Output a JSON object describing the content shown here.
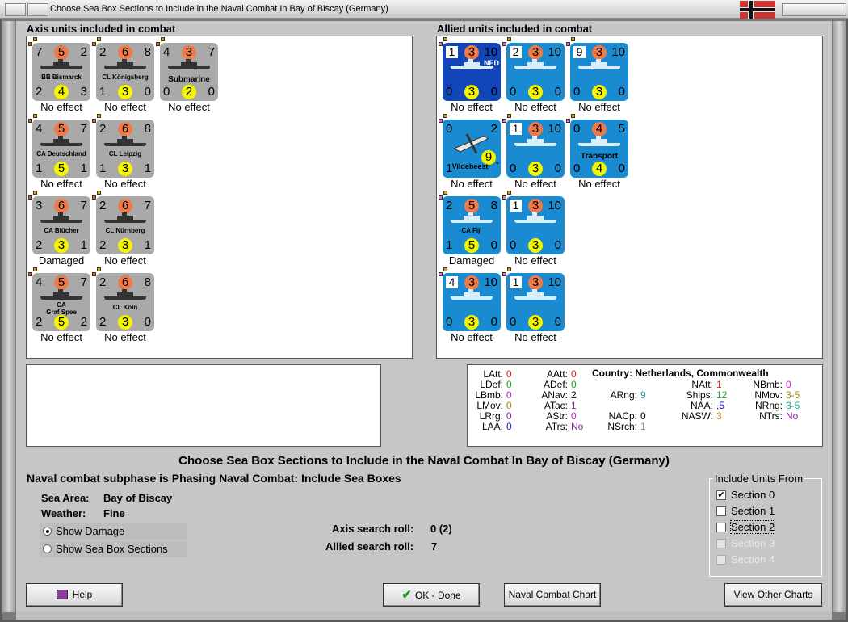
{
  "window": {
    "title": "Choose Sea Box Sections to Include in the Naval Combat In Bay of Biscay (Germany)"
  },
  "axis": {
    "title": "Axis units included in combat",
    "units": [
      {
        "tl": "7",
        "tm": "5",
        "tr": "2",
        "name": "BB Bismarck",
        "bl": "2",
        "bm": "4",
        "br": "3",
        "effect": "No effect"
      },
      {
        "tl": "2",
        "tm": "6",
        "tr": "8",
        "name": "CL Königsberg",
        "bl": "1",
        "bm": "3",
        "br": "0",
        "effect": "No effect"
      },
      {
        "tl": "4",
        "tm": "3",
        "tr": "7",
        "name": "Submarine",
        "bl": "0",
        "bm": "2",
        "br": "0",
        "effect": "No effect"
      },
      {
        "tl": "4",
        "tm": "5",
        "tr": "7",
        "name": "CA Deutschland",
        "bl": "1",
        "bm": "5",
        "br": "1",
        "effect": "No effect"
      },
      {
        "tl": "2",
        "tm": "6",
        "tr": "8",
        "name": "CL Leipzig",
        "bl": "1",
        "bm": "3",
        "br": "1",
        "effect": "No effect"
      },
      {
        "tl": "3",
        "tm": "6",
        "tr": "7",
        "name": "CA Blücher",
        "bl": "2",
        "bm": "3",
        "br": "1",
        "effect": "Damaged"
      },
      {
        "tl": "2",
        "tm": "6",
        "tr": "7",
        "name": "CL Nürnberg",
        "bl": "2",
        "bm": "3",
        "br": "1",
        "effect": "No effect"
      },
      {
        "tl": "4",
        "tm": "5",
        "tr": "7",
        "name": "CA",
        "name2": "Graf Spee",
        "bl": "2",
        "bm": "5",
        "br": "2",
        "effect": "No effect"
      },
      {
        "tl": "2",
        "tm": "6",
        "tr": "8",
        "name": "CL Köln",
        "bl": "2",
        "bm": "3",
        "br": "0",
        "effect": "No effect"
      }
    ]
  },
  "allied": {
    "title": "Allied units included in combat",
    "units": [
      {
        "tl": "1",
        "tm": "3",
        "tr": "10",
        "tag": "NED",
        "bl": "0",
        "bm": "3",
        "br": "0",
        "effect": "No effect"
      },
      {
        "tl": "2",
        "tm": "3",
        "tr": "10",
        "bl": "0",
        "bm": "3",
        "br": "0",
        "effect": "No effect"
      },
      {
        "tl": "9",
        "tm": "3",
        "tr": "10",
        "bl": "0",
        "bm": "3",
        "br": "0",
        "effect": "No effect"
      },
      {
        "tl": "0",
        "tr": "2",
        "name": "Vildebeest",
        "bl": "1",
        "bm": "9",
        "br": "*",
        "effect": "No effect"
      },
      {
        "tl": "1",
        "tm": "3",
        "tr": "10",
        "bl": "0",
        "bm": "3",
        "br": "0",
        "effect": "No effect"
      },
      {
        "tl": "0",
        "tm": "4",
        "tr": "5",
        "name": "Transport",
        "bl": "0",
        "bm": "4",
        "br": "0",
        "effect": "No effect"
      },
      {
        "tl": "2",
        "tm": "5",
        "tr": "8",
        "name": "CA Fiji",
        "bl": "1",
        "bm": "5",
        "br": "0",
        "effect": "Damaged"
      },
      {
        "tl": "1",
        "tm": "3",
        "tr": "10",
        "bl": "0",
        "bm": "3",
        "br": "0",
        "effect": "No effect"
      },
      {
        "tl": "4",
        "tm": "3",
        "tr": "10",
        "bl": "0",
        "bm": "3",
        "br": "0",
        "effect": "No effect"
      },
      {
        "tl": "1",
        "tm": "3",
        "tr": "10",
        "bl": "0",
        "bm": "3",
        "br": "0",
        "effect": "No effect"
      }
    ]
  },
  "stats": {
    "country_label": "Country:",
    "country": "Netherlands, Commonwealth",
    "items": [
      {
        "k": "LAtt:",
        "v": "0"
      },
      {
        "k": "LDef:",
        "v": "0"
      },
      {
        "k": "LBmb:",
        "v": "0"
      },
      {
        "k": "LMov:",
        "v": "0"
      },
      {
        "k": "LRrg:",
        "v": "0"
      },
      {
        "k": "LAA:",
        "v": "0"
      },
      {
        "k": "AAtt:",
        "v": "0"
      },
      {
        "k": "ADef:",
        "v": "0"
      },
      {
        "k": "ANav:",
        "v": "2"
      },
      {
        "k": "ATac:",
        "v": "1"
      },
      {
        "k": "AStr:",
        "v": "0"
      },
      {
        "k": "ATrs:",
        "v": "No"
      },
      {
        "k": "ARng:",
        "v": "9"
      },
      {
        "k": "NACp:",
        "v": "0"
      },
      {
        "k": "NSrch:",
        "v": "1"
      },
      {
        "k": "NAtt:",
        "v": "1"
      },
      {
        "k": "Ships:",
        "v": "12"
      },
      {
        "k": "NAA:",
        "v": ",5"
      },
      {
        "k": "NASW:",
        "v": "3"
      },
      {
        "k": "NBmb:",
        "v": "0"
      },
      {
        "k": "NMov:",
        "v": "3-5"
      },
      {
        "k": "NRng:",
        "v": "3-5"
      },
      {
        "k": "NTrs:",
        "v": "No"
      }
    ]
  },
  "heading": "Choose Sea Box Sections to Include in the Naval Combat In Bay of Biscay (Germany)",
  "subphase": "Naval combat subphase is Phasing Naval Combat: Include Sea Boxes",
  "sea_area_label": "Sea Area:",
  "sea_area": "Bay of Biscay",
  "weather_label": "Weather:",
  "weather": "Fine",
  "show_damage": "Show Damage",
  "show_sections": "Show Sea Box Sections",
  "axis_roll_label": "Axis search roll:",
  "axis_roll": "0 (2)",
  "allied_roll_label": "Allied search roll:",
  "allied_roll": "7",
  "include": {
    "title": "Include Units From",
    "sections": [
      "Section 0",
      "Section 1",
      "Section 2",
      "Section 3",
      "Section 4"
    ]
  },
  "buttons": {
    "help": "Help",
    "ok": "OK - Done",
    "chart": "Naval Combat Chart",
    "other": "View Other Charts"
  }
}
